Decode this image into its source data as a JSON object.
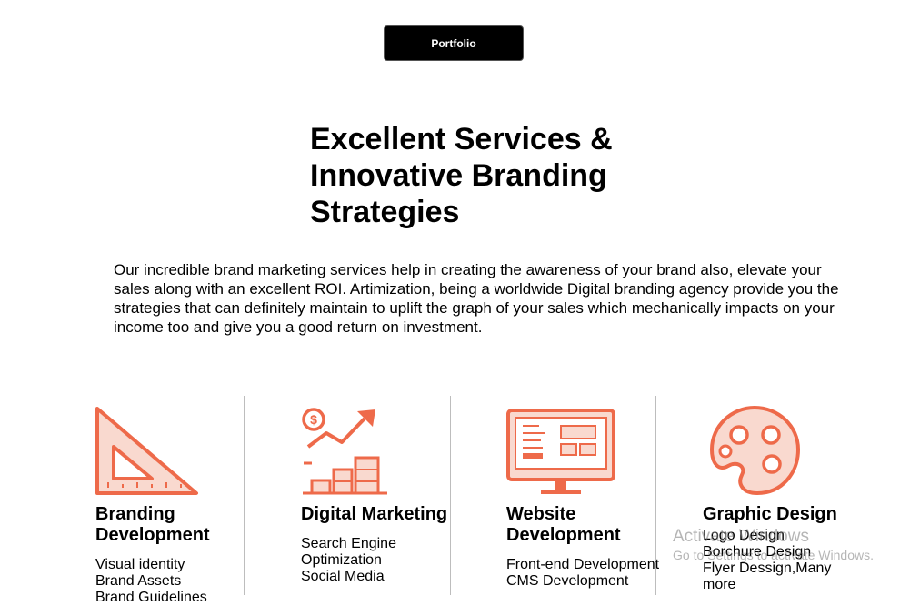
{
  "header": {
    "portfolio_label": "Portfolio"
  },
  "hero": {
    "title": "Excellent Services & Innovative Branding Strategies",
    "description": "Our incredible brand marketing services help in creating the awareness of your brand also, elevate your sales along with an excellent ROI. Artimization, being a worldwide Digital branding agency provide you the strategies that can definitely maintain to uplift the graph of your sales which mechanically impacts on your income too and give you a good return on investment."
  },
  "colors": {
    "accent": "#ee6a4a",
    "accent_light": "#f9d9cf"
  },
  "services": [
    {
      "icon": "set-square-icon",
      "title": "Branding Development",
      "items": [
        "Visual identity",
        "Brand Assets",
        "Brand Guidelines"
      ]
    },
    {
      "icon": "growth-chart-icon",
      "title": "Digital Marketing",
      "items": [
        "Search Engine Optimization",
        "Social Media"
      ]
    },
    {
      "icon": "monitor-icon",
      "title": "Website Development",
      "items": [
        "Front-end Development",
        "CMS Development"
      ]
    },
    {
      "icon": "palette-icon",
      "title": "Graphic Design",
      "items": [
        "Logo Design",
        "Borchure Design",
        "Flyer Dessign,Many more"
      ]
    }
  ],
  "watermark": {
    "title": "Activate Windows",
    "subtitle": "Go to Settings to activate Windows."
  }
}
